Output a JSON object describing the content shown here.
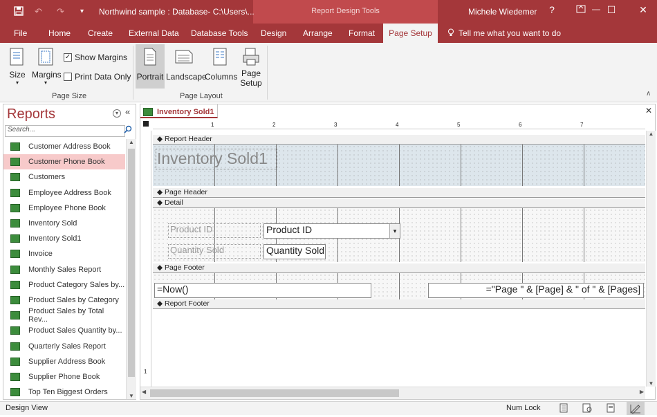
{
  "titlebar": {
    "doc_title": "Northwind sample : Database- C:\\Users\\...",
    "context_title": "Report Design Tools",
    "user": "Michele Wiedemer",
    "help": "?",
    "minimize": "—",
    "maximize": "☐",
    "close": "✕"
  },
  "tabs": [
    {
      "label": "File"
    },
    {
      "label": "Home"
    },
    {
      "label": "Create"
    },
    {
      "label": "External Data"
    },
    {
      "label": "Database Tools"
    },
    {
      "label": "Design"
    },
    {
      "label": "Arrange"
    },
    {
      "label": "Format"
    },
    {
      "label": "Page Setup"
    }
  ],
  "tell_me": "Tell me what you want to do",
  "ribbon": {
    "size": "Size",
    "margins": "Margins",
    "show_margins": "Show Margins",
    "show_margins_checked": true,
    "print_data_only": "Print Data Only",
    "print_data_only_checked": false,
    "page_size_group": "Page Size",
    "portrait": "Portrait",
    "landscape": "Landscape",
    "columns": "Columns",
    "page_setup_l1": "Page",
    "page_setup_l2": "Setup",
    "page_layout_group": "Page Layout"
  },
  "nav": {
    "title": "Reports",
    "search_placeholder": "Search...",
    "items": [
      "Customer Address Book",
      "Customer Phone Book",
      "Customers",
      "Employee Address Book",
      "Employee Phone Book",
      "Inventory Sold",
      "Inventory Sold1",
      "Invoice",
      "Monthly Sales Report",
      "Product Category Sales by...",
      "Product Sales by Category",
      "Product Sales by Total Rev...",
      "Product Sales Quantity by...",
      "Quarterly Sales Report",
      "Supplier Address Book",
      "Supplier Phone Book",
      "Top Ten Biggest Orders"
    ],
    "selected": "Customer Phone Book"
  },
  "document": {
    "tab": "Inventory Sold1",
    "ruler_marks": [
      "1",
      "2",
      "3",
      "4",
      "5",
      "6",
      "7"
    ],
    "vruler_mark": "1",
    "report_header": "Report Header",
    "title_label": "Inventory Sold1",
    "page_header": "Page Header",
    "detail": "Detail",
    "product_id_label": "Product ID",
    "product_id_field": "Product ID",
    "quantity_label": "Quantity Sold",
    "quantity_field": "Quantity Sold",
    "page_footer": "Page Footer",
    "now_field": "=Now()",
    "page_field": "=\"Page \" & [Page] & \" of \" & [Pages]",
    "report_footer": "Report Footer"
  },
  "status": {
    "view": "Design View",
    "num_lock": "Num Lock"
  },
  "colors": {
    "accent": "#a4373a",
    "selected": "#f7caca"
  }
}
